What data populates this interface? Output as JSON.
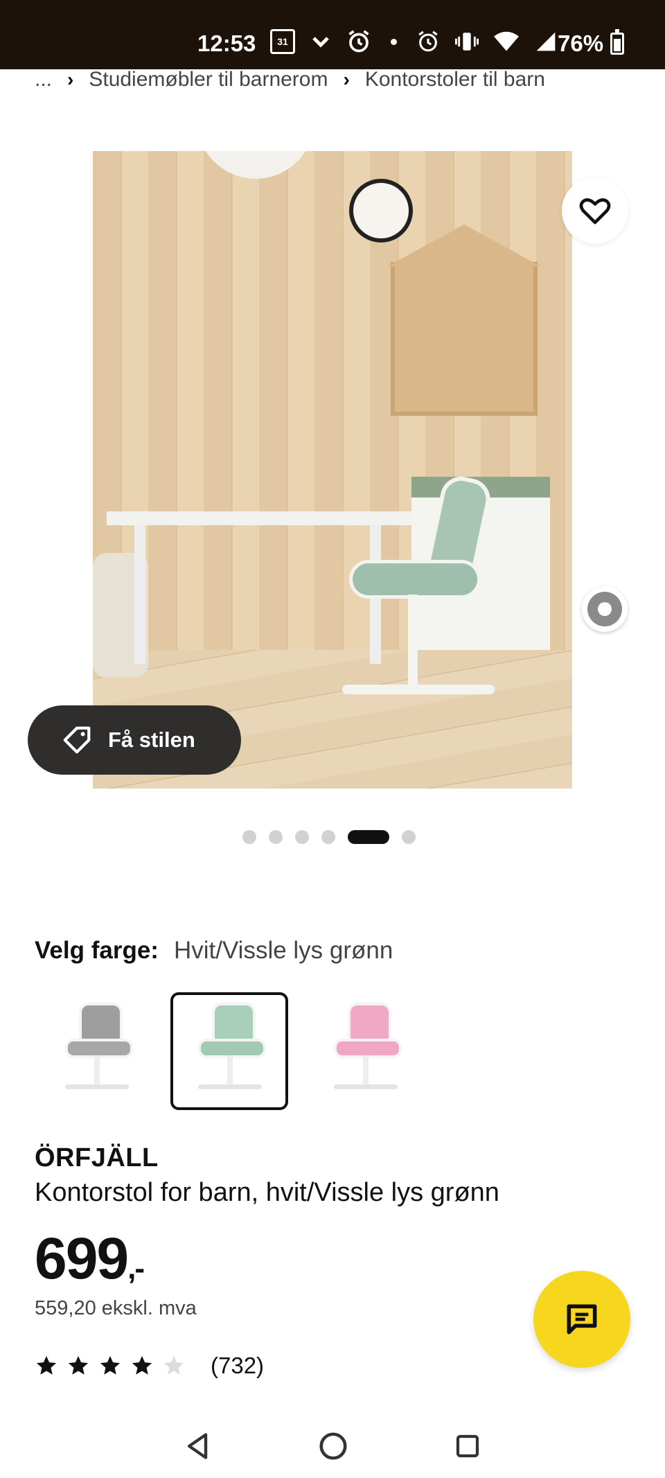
{
  "status_bar": {
    "time": "12:53",
    "calendar_day": "31",
    "battery": "76%"
  },
  "breadcrumb": {
    "ellipsis": "...",
    "items": [
      "Studiemøbler til barnerom",
      "Kontorstoler til barn"
    ]
  },
  "gallery": {
    "get_style_label": "Få stilen",
    "dot_count": 6,
    "active_dot_index": 4
  },
  "color_select": {
    "label": "Velg farge:",
    "selected_value": "Hvit/Vissle lys grønn",
    "swatches": [
      {
        "name": "grey",
        "back": "#9e9e9e",
        "seat": "#a7a7a7",
        "selected": false
      },
      {
        "name": "green",
        "back": "#a8cdb9",
        "seat": "#a2c9b4",
        "selected": true
      },
      {
        "name": "pink",
        "back": "#f0a9c5",
        "seat": "#efa7c4",
        "selected": false
      }
    ]
  },
  "product": {
    "name": "ÖRFJÄLL",
    "description": "Kontorstol for barn, hvit/Vissle lys grønn",
    "price_main": "699",
    "price_suffix": ",-",
    "price_ex_vat": "559,20 ekskl. mva",
    "rating": {
      "stars_filled": 4,
      "stars_total": 5,
      "review_count": "(732)"
    }
  },
  "colors": {
    "status_bar_bg": "#1c1209",
    "chat_button": "#f7d61e",
    "style_button_bg": "#2f2e2c"
  }
}
